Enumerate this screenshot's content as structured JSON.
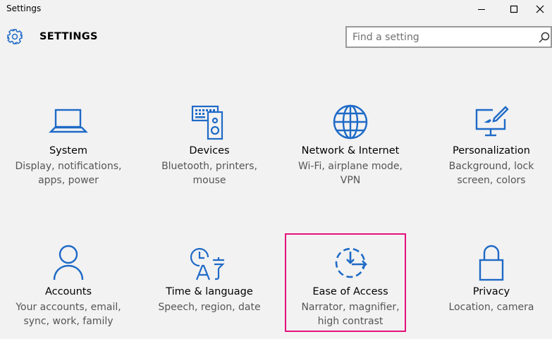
{
  "window": {
    "title": "Settings",
    "minimize_icon": "minimize-icon",
    "maximize_icon": "maximize-icon",
    "close_icon": "close-icon"
  },
  "header": {
    "icon": "gear-icon",
    "title": "SETTINGS"
  },
  "search": {
    "placeholder": "Find a setting",
    "icon": "search-icon"
  },
  "accent_color": "#1e6ac7",
  "selection_color": "#e3127b",
  "tiles": [
    {
      "name": "System",
      "desc1": "Display, notifications,",
      "desc2": "apps, power",
      "icon": "laptop-icon"
    },
    {
      "name": "Devices",
      "desc1": "Bluetooth, printers,",
      "desc2": "mouse",
      "icon": "devices-icon"
    },
    {
      "name": "Network & Internet",
      "desc1": "Wi-Fi, airplane mode,",
      "desc2": "VPN",
      "icon": "globe-icon"
    },
    {
      "name": "Personalization",
      "desc1": "Background, lock",
      "desc2": "screen, colors",
      "icon": "paint-icon"
    },
    {
      "name": "Accounts",
      "desc1": "Your accounts, email,",
      "desc2": "sync, work, family",
      "icon": "person-icon"
    },
    {
      "name": "Time & language",
      "desc1": "Speech, region, date",
      "desc2": "",
      "icon": "time-language-icon"
    },
    {
      "name": "Ease of Access",
      "desc1": "Narrator, magnifier,",
      "desc2": "high contrast",
      "icon": "ease-of-access-icon",
      "selected": true
    },
    {
      "name": "Privacy",
      "desc1": "Location, camera",
      "desc2": "",
      "icon": "lock-icon"
    }
  ]
}
